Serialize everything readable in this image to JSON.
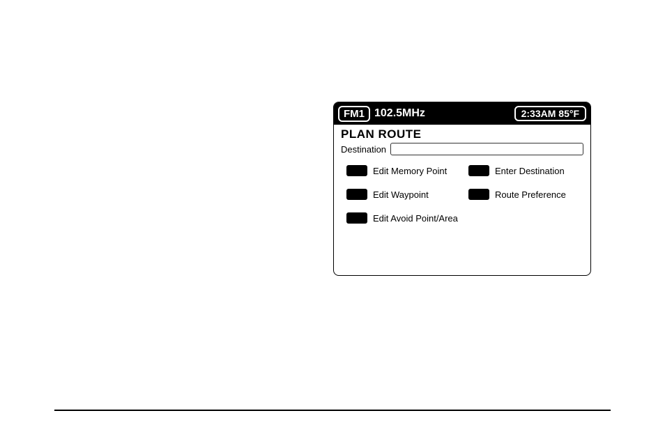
{
  "header": {
    "band": "FM1",
    "frequency": "102.5MHz",
    "time_temp": "2:33AM 85°F"
  },
  "screen": {
    "title": "PLAN ROUTE",
    "destination_label": "Destination",
    "destination_value": ""
  },
  "options": {
    "edit_memory_point": "Edit Memory Point",
    "enter_destination": "Enter Destination",
    "edit_waypoint": "Edit Waypoint",
    "route_preference": "Route Preference",
    "edit_avoid": "Edit Avoid Point/Area"
  }
}
